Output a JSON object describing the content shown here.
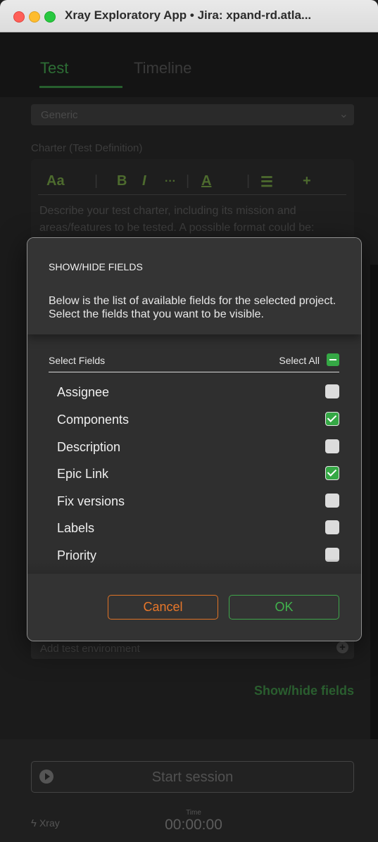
{
  "window": {
    "title": "Xray Exploratory App • Jira: xpand-rd.atla..."
  },
  "tabs": [
    {
      "label": "Test"
    },
    {
      "label": "Timeline"
    }
  ],
  "form": {
    "type_value": "Generic",
    "charter_label": "Charter (Test Definition)",
    "editor_placeholder": "Describe your test charter, including its mission and areas/features to be tested. A possible format could be:",
    "toolbar": {
      "font": "Aa",
      "bold": "B",
      "italic": "I",
      "more": "···",
      "color": "A",
      "list": "☰",
      "insert": "+"
    },
    "environment_placeholder": "Add test environment",
    "show_hide_link": "Show/hide fields"
  },
  "footer": {
    "start_session_label": "Start session",
    "brand": "Xray",
    "time_label": "Time",
    "time_value": "00:00:00"
  },
  "modal": {
    "title": "SHOW/HIDE FIELDS",
    "description": "Below is the list of available fields for the selected project. Select the fields that you want to be visible.",
    "list_header_left": "Select Fields",
    "list_header_right": "Select All",
    "fields": [
      {
        "label": "Assignee",
        "checked": false
      },
      {
        "label": "Components",
        "checked": true
      },
      {
        "label": "Description",
        "checked": false
      },
      {
        "label": "Epic Link",
        "checked": true
      },
      {
        "label": "Fix versions",
        "checked": false
      },
      {
        "label": "Labels",
        "checked": false
      },
      {
        "label": "Priority",
        "checked": false
      }
    ],
    "cancel_label": "Cancel",
    "ok_label": "OK"
  },
  "colors": {
    "accent_green": "#35a845",
    "cancel_orange": "#e07326"
  }
}
